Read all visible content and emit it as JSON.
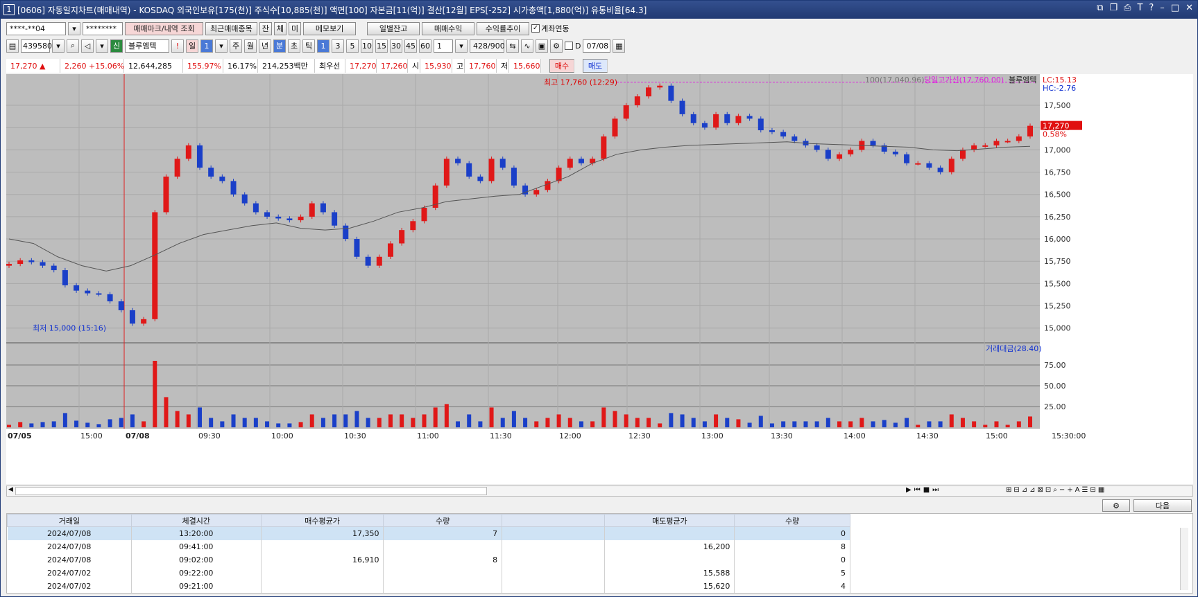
{
  "title": {
    "num": "1",
    "text": "[0606] 자동일지차트(매매내역) - KOSDAQ 외국인보유[175(천)] 주식수[10,885(천)] 액면[100] 자본금[11(억)] 결산[12월] EPS[-252] 시가총액[1,880(억)] 유통비율[64.3]"
  },
  "toolbar1": {
    "account": "****-**04",
    "password": "********",
    "btn_trade": "매매마크/내역 조회",
    "btn_recent": "최근매매종목",
    "btn_jan": "잔",
    "btn_che": "체",
    "btn_mi": "미",
    "btn_memo": "메모보기",
    "btn_daily": "일별잔고",
    "btn_profit": "매매수익",
    "btn_rate": "수익률추이",
    "chk_link": "계좌연동"
  },
  "toolbar2": {
    "code": "439580",
    "new": "신",
    "name": "블루엠텍",
    "day": "일",
    "dayval": "1",
    "periods": [
      "주",
      "월",
      "년",
      "분",
      "초",
      "틱",
      "1",
      "3",
      "5",
      "10",
      "15",
      "30",
      "45",
      "60"
    ],
    "count": "1",
    "range": "428/900",
    "d": "D",
    "date": "07/08"
  },
  "quote": {
    "price": "17,270",
    "arrow": "▲",
    "change": "2,260",
    "pct": "+15.06%",
    "volume": "12,644,285",
    "ratio": "155.97%",
    "turnover": "16.17%",
    "amount": "214,253백만",
    "best_label": "최우선",
    "ask": "17,270",
    "bid": "17,260",
    "open_l": "시",
    "open": "15,930",
    "high_l": "고",
    "high": "17,760",
    "low_l": "저",
    "low": "15,660",
    "buy": "매수",
    "sell": "매도"
  },
  "chart_data": {
    "type": "candlestick",
    "title": "",
    "legend": [
      "100(17,040.96)",
      "당일고가선(17,760.00)",
      "블루엠텍"
    ],
    "lc": "LC:15.13",
    "hc": "HC:-2.76",
    "price_label": "17,270",
    "price_pct": "0.58%",
    "high_note": "최고 17,760 (12:29)",
    "low_note": "최저 15,000 (15:16)",
    "yticks": [
      "17,500",
      "17,250",
      "17,000",
      "16,750",
      "16,500",
      "16,250",
      "16,000",
      "15,750",
      "15,500",
      "15,250",
      "15,000"
    ],
    "ylim": [
      14850,
      17850
    ],
    "vol_label": "거래대금(28.40)",
    "vol_ticks": [
      "75.00",
      "50.00",
      "25.00"
    ],
    "xticks": [
      "07/05",
      "15:00",
      "07/08",
      "09:30",
      "10:00",
      "10:30",
      "11:00",
      "11:30",
      "12:00",
      "12:30",
      "13:00",
      "13:30",
      "14:00",
      "14:30",
      "15:00",
      "15:30:00"
    ],
    "close": [
      15720,
      15760,
      15740,
      15700,
      15650,
      15480,
      15420,
      15390,
      15380,
      15300,
      15200,
      15050,
      15100,
      16300,
      16700,
      16900,
      17050,
      16800,
      16700,
      16650,
      16500,
      16400,
      16300,
      16250,
      16230,
      16210,
      16250,
      16400,
      16300,
      16150,
      16000,
      15800,
      15700,
      15800,
      15950,
      16100,
      16200,
      16350,
      16600,
      16900,
      16850,
      16700,
      16650,
      16900,
      16800,
      16600,
      16500,
      16550,
      16650,
      16800,
      16900,
      16850,
      16900,
      17150,
      17350,
      17500,
      17600,
      17700,
      17720,
      17550,
      17400,
      17300,
      17250,
      17400,
      17300,
      17380,
      17350,
      17220,
      17200,
      17150,
      17100,
      17050,
      17000,
      16900,
      16950,
      17000,
      17100,
      17050,
      16980,
      16950,
      16850,
      16850,
      16800,
      16750,
      16900,
      17000,
      17050,
      17050,
      17100,
      17100,
      17150,
      17270
    ],
    "ma": [
      16000,
      15950,
      15800,
      15700,
      15640,
      15700,
      15820,
      15950,
      16050,
      16100,
      16150,
      16180,
      16120,
      16100,
      16120,
      16200,
      16300,
      16350,
      16420,
      16450,
      16480,
      16500,
      16600,
      16700,
      16850,
      16950,
      17000,
      17030,
      17050,
      17060,
      17070,
      17080,
      17090,
      17070,
      17060,
      17050,
      17040,
      17030,
      17000,
      16990,
      17010,
      17030,
      17040
    ]
  },
  "buttons": {
    "next": "다음"
  },
  "table": {
    "headers": [
      "거래일",
      "체결시간",
      "매수평균가",
      "수량",
      "",
      "매도평균가",
      "수량"
    ],
    "rows": [
      [
        "2024/07/08",
        "13:20:00",
        "17,350",
        "7",
        "",
        "",
        "0"
      ],
      [
        "2024/07/08",
        "09:41:00",
        "",
        "",
        "",
        "16,200",
        "8"
      ],
      [
        "2024/07/08",
        "09:02:00",
        "16,910",
        "8",
        "",
        "",
        "0"
      ],
      [
        "2024/07/02",
        "09:22:00",
        "",
        "",
        "",
        "15,588",
        "5"
      ],
      [
        "2024/07/02",
        "09:21:00",
        "",
        "",
        "",
        "15,620",
        "4"
      ]
    ]
  }
}
